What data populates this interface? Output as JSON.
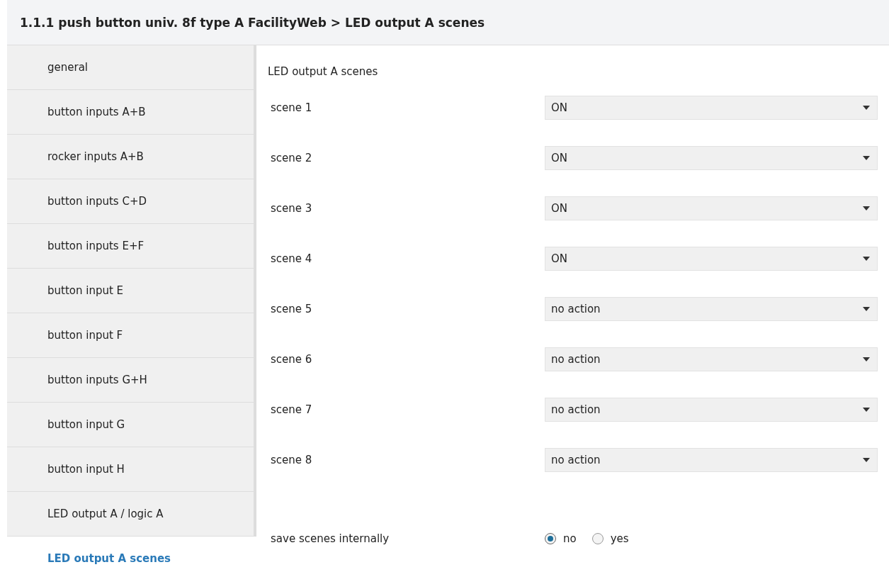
{
  "header": {
    "title": "1.1.1 push button univ. 8f type A FacilityWeb > LED output A scenes"
  },
  "sidebar": {
    "items": [
      {
        "label": "general",
        "selected": false
      },
      {
        "label": "button inputs A+B",
        "selected": false
      },
      {
        "label": "rocker inputs A+B",
        "selected": false
      },
      {
        "label": "button inputs C+D",
        "selected": false
      },
      {
        "label": "button inputs E+F",
        "selected": false
      },
      {
        "label": "button input E",
        "selected": false
      },
      {
        "label": "button input F",
        "selected": false
      },
      {
        "label": "button inputs G+H",
        "selected": false
      },
      {
        "label": "button input G",
        "selected": false
      },
      {
        "label": "button input H",
        "selected": false
      },
      {
        "label": "LED output A / logic A",
        "selected": false
      },
      {
        "label": "LED output A scenes",
        "selected": true
      }
    ]
  },
  "content": {
    "title": "LED output A scenes",
    "scenes": [
      {
        "label": "scene 1",
        "value": "ON"
      },
      {
        "label": "scene 2",
        "value": "ON"
      },
      {
        "label": "scene 3",
        "value": "ON"
      },
      {
        "label": "scene 4",
        "value": "ON"
      },
      {
        "label": "scene 5",
        "value": "no action"
      },
      {
        "label": "scene 6",
        "value": "no action"
      },
      {
        "label": "scene 7",
        "value": "no action"
      },
      {
        "label": "scene 8",
        "value": "no action"
      }
    ],
    "save": {
      "label": "save scenes internally",
      "options": [
        {
          "label": "no",
          "selected": true
        },
        {
          "label": "yes",
          "selected": false
        }
      ]
    }
  }
}
